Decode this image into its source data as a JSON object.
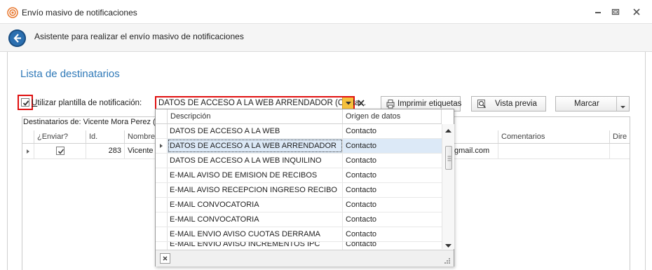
{
  "window": {
    "title": "Envío masivo de notificaciones"
  },
  "wizard": {
    "title": "Asistente para realizar el envío masivo de notificaciones"
  },
  "section": {
    "title": "Lista de destinatarios"
  },
  "template": {
    "use_label_u": "U",
    "use_label_rest": "tilizar plantilla de notificación:",
    "checked": true,
    "selected": "DATOS DE ACCESO A LA WEB ARRENDADOR (Conta..."
  },
  "toolbar": {
    "print_labels": "Imprimir etiquetas",
    "preview": "Vista previa",
    "mark": "Marcar"
  },
  "grid": {
    "caption": "Destinatarios de: Vicente Mora Perez (A",
    "columns": [
      "¿Enviar?",
      "Id.",
      "Nombre",
      "Comentarios",
      "Dire"
    ],
    "rows": [
      {
        "send": true,
        "id": "283",
        "name": "Vicente",
        "email_tail": "gmail.com",
        "comments": ""
      }
    ]
  },
  "dropdown": {
    "headers": [
      "Descripción",
      "Origen de datos"
    ],
    "rows": [
      {
        "desc": "DATOS DE ACCESO A LA WEB",
        "origin": "Contacto"
      },
      {
        "desc": "DATOS DE ACCESO A LA WEB ARRENDADOR",
        "origin": "Contacto",
        "selected": true
      },
      {
        "desc": "DATOS DE ACCESO A LA WEB INQUILINO",
        "origin": "Contacto"
      },
      {
        "desc": "E-MAIL AVISO DE EMISION DE RECIBOS",
        "origin": "Contacto"
      },
      {
        "desc": "E-MAIL AVISO RECEPCION INGRESO RECIBO",
        "origin": "Contacto"
      },
      {
        "desc": "E-MAIL CONVOCATORIA",
        "origin": "Contacto"
      },
      {
        "desc": "E-MAIL CONVOCATORIA",
        "origin": "Contacto"
      },
      {
        "desc": "E-MAIL ENVIO AVISO CUOTAS DERRAMA",
        "origin": "Contacto"
      },
      {
        "desc": "E-MAIL ENVIO AVISO INCREMENTOS IPC",
        "origin": "Contacto"
      }
    ]
  },
  "colors": {
    "accent": "#2f79b8",
    "highlight_border": "#e01010",
    "dropdown_button": "#f5c13d",
    "selection": "#dce9f7"
  },
  "icons": [
    "notification-app-icon",
    "minimize-icon",
    "restore-icon",
    "close-icon",
    "back-arrow-icon",
    "checkmark-icon",
    "dropdown-arrow-icon",
    "clear-icon",
    "print-icon",
    "preview-icon",
    "row-indicator-icon",
    "scroll-up-icon",
    "scroll-down-icon",
    "resize-grip-icon"
  ]
}
